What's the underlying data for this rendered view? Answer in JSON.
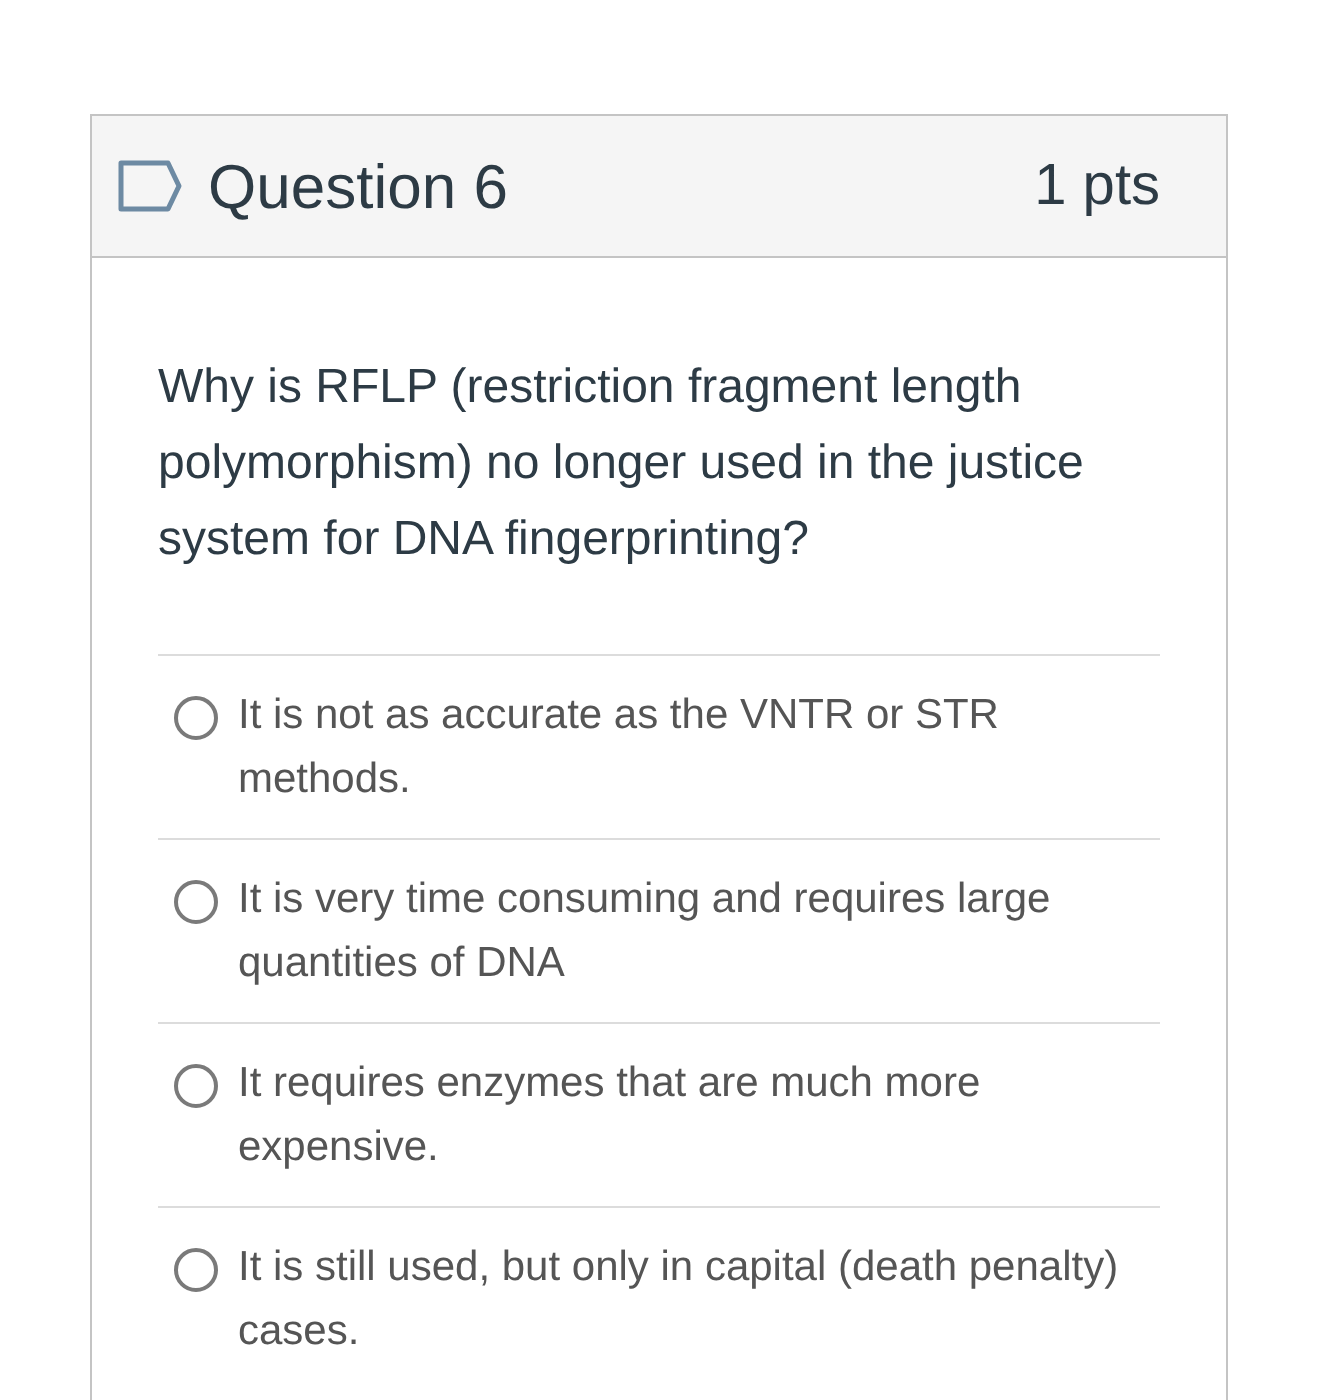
{
  "question": {
    "flagged": false,
    "title": "Question 6",
    "points": "1 pts",
    "text": "Why is RFLP (restriction fragment length polymorphism) no longer used in the justice system for DNA fingerprinting?"
  },
  "answers": [
    {
      "text": "It is not as accurate as the VNTR or STR methods.",
      "selected": false
    },
    {
      "text": "It is very time consuming and requires large quantities of DNA",
      "selected": false
    },
    {
      "text": "It requires enzymes that are much more expensive.",
      "selected": false
    },
    {
      "text": "It is still used, but only in capital (death penalty) cases.",
      "selected": false
    }
  ]
}
